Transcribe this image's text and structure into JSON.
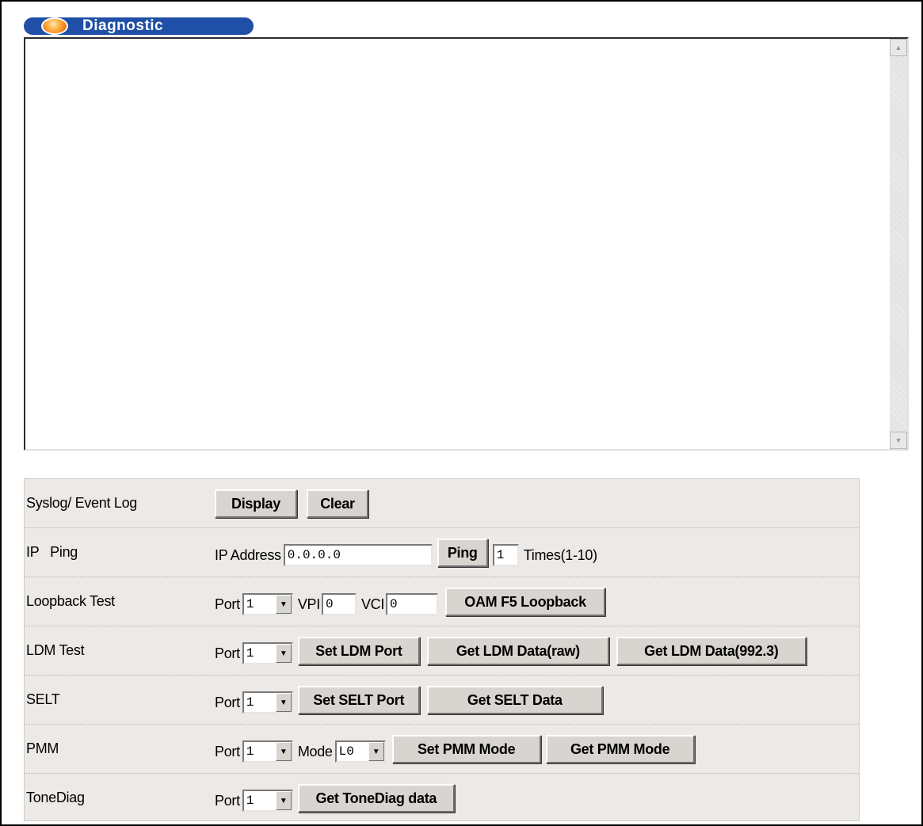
{
  "header": {
    "title": "Diagnostic"
  },
  "log": {
    "value": ""
  },
  "icons": {
    "title_orb": "orange-orb-icon",
    "scroll_up": "scroll-up-arrow-icon",
    "scroll_down": "scroll-down-arrow-icon",
    "dropdown": "chevron-down-icon"
  },
  "rows": {
    "syslog": {
      "label": "Syslog/ Event Log",
      "display_button": "Display",
      "clear_button": "Clear"
    },
    "ping": {
      "label": "IP   Ping",
      "ip_label": "IP Address",
      "ip_value": "0.0.0.0",
      "ping_button": "Ping",
      "times_value": "1",
      "times_label": "Times(1-10)"
    },
    "loopback": {
      "label": "Loopback Test",
      "port_label": "Port",
      "port_value": "1",
      "vpi_label": "VPI",
      "vpi_value": "0",
      "vci_label": "VCI",
      "vci_value": "0",
      "oam_button": "OAM F5 Loopback"
    },
    "ldm": {
      "label": "LDM Test",
      "port_label": "Port",
      "port_value": "1",
      "set_button": "Set LDM Port",
      "get_raw_button": "Get LDM Data(raw)",
      "get_9923_button": "Get LDM Data(992.3)"
    },
    "selt": {
      "label": "SELT",
      "port_label": "Port",
      "port_value": "1",
      "set_button": "Set SELT Port",
      "get_button": "Get SELT Data"
    },
    "pmm": {
      "label": "PMM",
      "port_label": "Port",
      "port_value": "1",
      "mode_label": "Mode",
      "mode_value": "L0",
      "set_button": "Set PMM Mode",
      "get_button": "Get PMM Mode"
    },
    "tonediag": {
      "label": "ToneDiag",
      "port_label": "Port",
      "port_value": "1",
      "get_button": "Get ToneDiag data"
    }
  }
}
